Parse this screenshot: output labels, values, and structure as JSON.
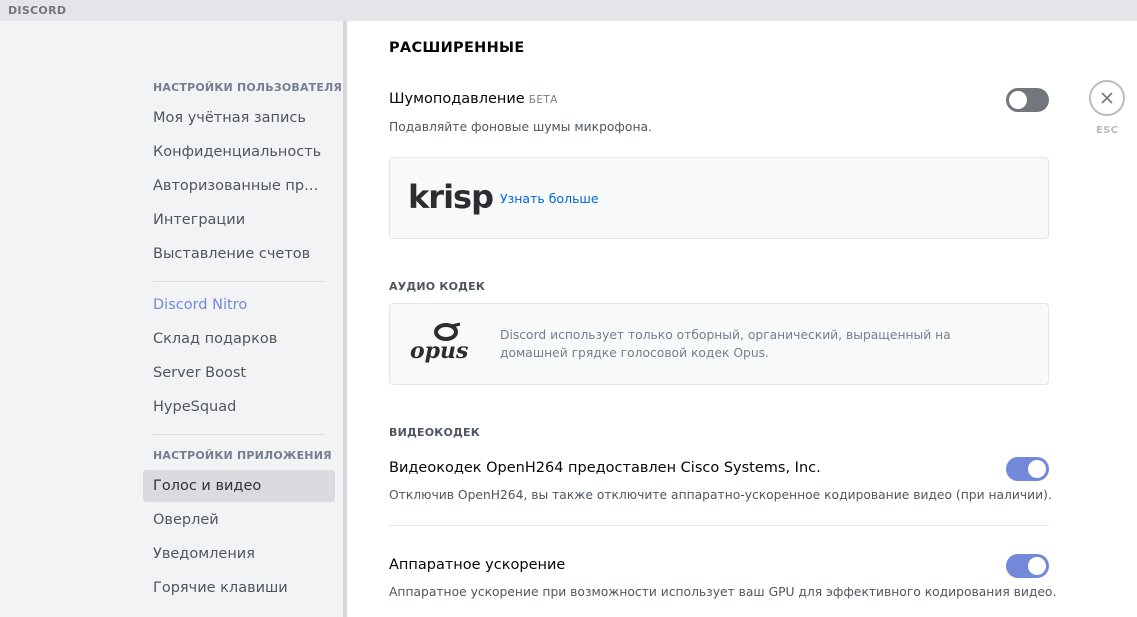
{
  "app": {
    "logo": "DISCORD"
  },
  "sidebar": {
    "user_settings_header": "НАСТРОЙКИ ПОЛЬЗОВАТЕЛЯ",
    "user_items": [
      {
        "label": "Моя учётная запись"
      },
      {
        "label": "Конфиденциальность"
      },
      {
        "label": "Авторизованные приложения"
      },
      {
        "label": "Интеграции"
      },
      {
        "label": "Выставление счетов"
      }
    ],
    "nitro_items": [
      {
        "label": "Discord Nitro"
      },
      {
        "label": "Склад подарков"
      },
      {
        "label": "Server Boost"
      },
      {
        "label": "HypeSquad"
      }
    ],
    "app_settings_header": "НАСТРОЙКИ ПРИЛОЖЕНИЯ",
    "app_items": [
      {
        "label": "Голос и видео",
        "selected": true
      },
      {
        "label": "Оверлей"
      },
      {
        "label": "Уведомления"
      },
      {
        "label": "Горячие клавиши"
      }
    ]
  },
  "content": {
    "title": "РАСШИРЕННЫЕ",
    "noise": {
      "title": "Шумоподавление",
      "badge": "БЕТА",
      "description": "Подавляйте фоновые шумы микрофона.",
      "enabled": false
    },
    "krisp": {
      "logo_text": "krisp",
      "link": "Узнать больше"
    },
    "audio_codec": {
      "header": "АУДИО КОДЕК",
      "logo_text": "opus",
      "description": "Discord использует только отборный, органический, выращенный на домашней грядке голосовой кодек Opus."
    },
    "video_codec": {
      "header": "ВИДЕОКОДЕК",
      "openh264_title": "Видеокодек OpenH264 предоставлен Cisco Systems, Inc.",
      "openh264_desc": "Отключив OpenH264, вы также отключите аппаратно-ускоренное кодирование видео (при наличии).",
      "openh264_enabled": true,
      "hw_title": "Аппаратное ускорение",
      "hw_desc": "Аппаратное ускорение при возможности использует ваш GPU для эффективного кодирования видео.",
      "hw_enabled": true
    },
    "close": {
      "label": "ESC"
    }
  },
  "colors": {
    "accent": "#7289da",
    "toggle_off": "#72767d",
    "link": "#0067e0"
  }
}
